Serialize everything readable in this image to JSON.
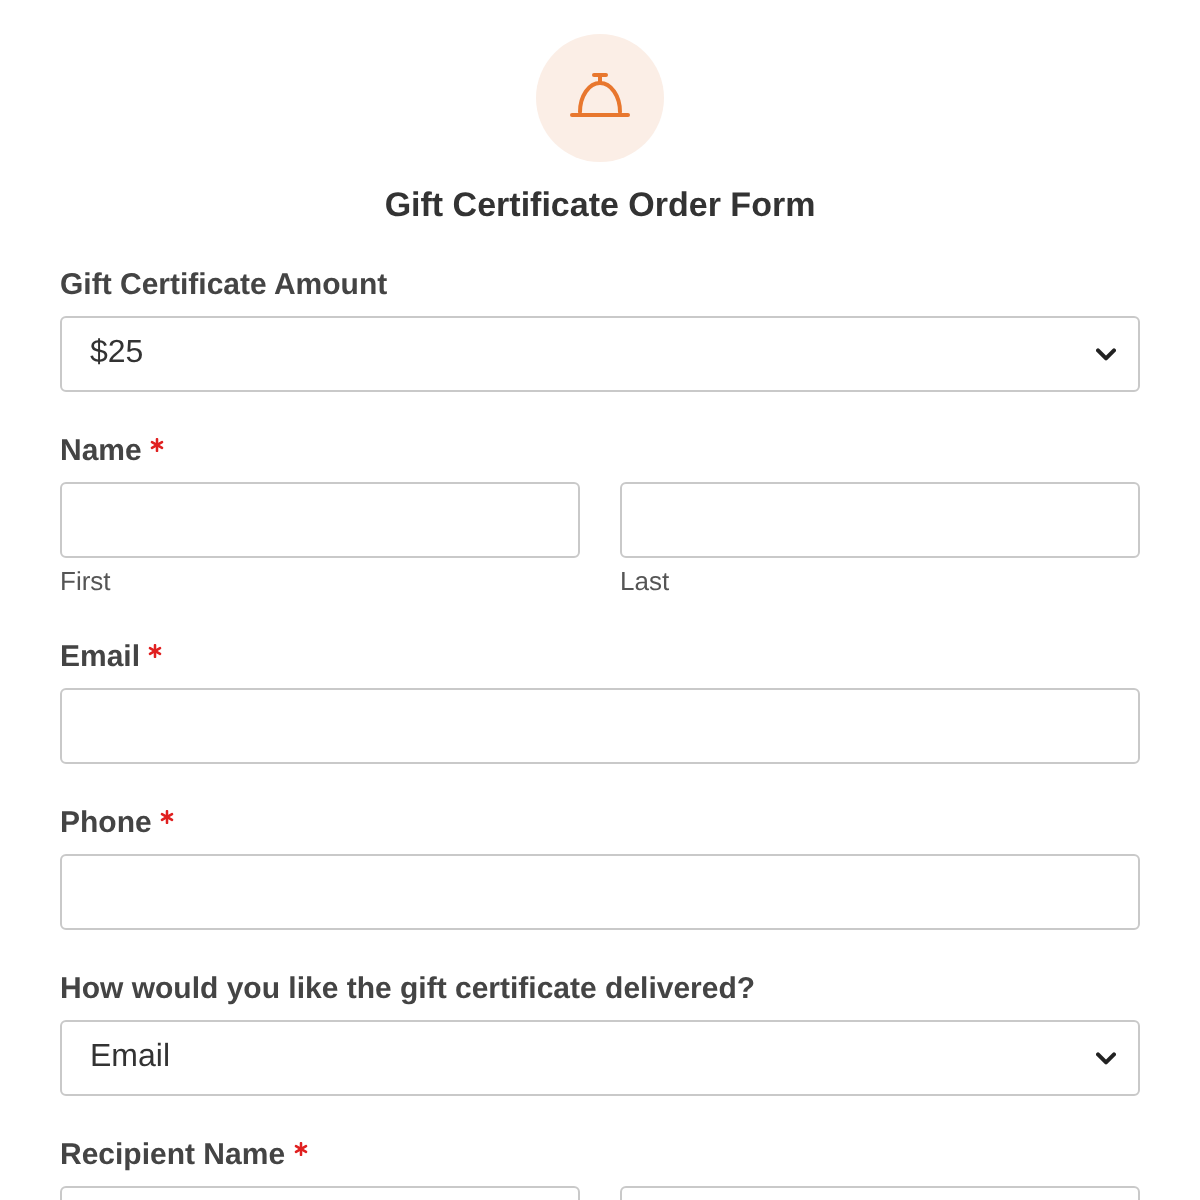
{
  "header": {
    "title": "Gift Certificate Order Form"
  },
  "fields": [
    {
      "kind": "select",
      "label": "Gift Certificate Amount",
      "required": false,
      "value": "$25"
    },
    {
      "kind": "name",
      "label": "Name",
      "required": true,
      "sublabels": [
        "First",
        "Last"
      ]
    },
    {
      "kind": "text",
      "label": "Email",
      "required": true
    },
    {
      "kind": "text",
      "label": "Phone",
      "required": true
    },
    {
      "kind": "select",
      "label": "How would you like the gift certificate delivered?",
      "required": false,
      "value": "Email"
    },
    {
      "kind": "name",
      "label": "Recipient Name",
      "required": true
    }
  ]
}
